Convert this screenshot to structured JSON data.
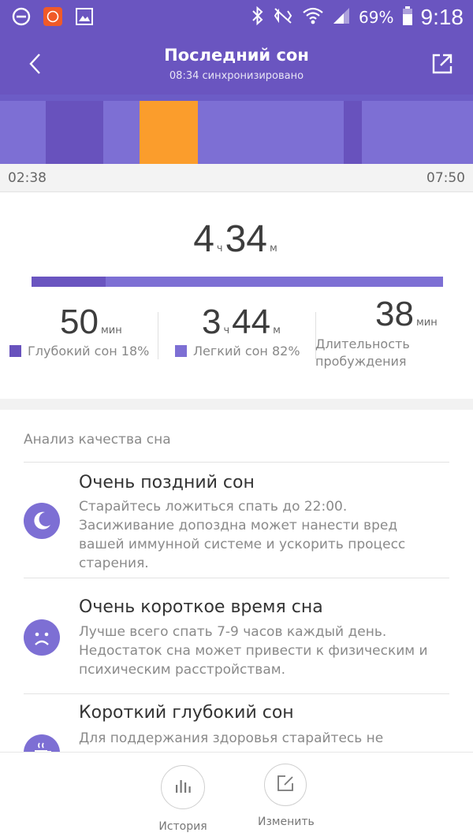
{
  "status_bar": {
    "battery_percent": "69%",
    "time": "9:18",
    "icons": [
      "minus-circle-icon",
      "mi-app-icon",
      "gallery-icon",
      "bluetooth-icon",
      "mute-vibrate-icon",
      "wifi-icon",
      "signal-icon",
      "battery-icon"
    ]
  },
  "header": {
    "title": "Последний сон",
    "subtitle": "08:34 синхронизировано",
    "back_icon": "back-chevron-icon",
    "share_icon": "share-icon"
  },
  "timeline": {
    "start_time": "02:38",
    "end_time": "07:50",
    "segments": [
      {
        "type": "light",
        "start": 0.0,
        "end": 0.097
      },
      {
        "type": "deep",
        "start": 0.097,
        "end": 0.218
      },
      {
        "type": "light",
        "start": 0.218,
        "end": 0.295
      },
      {
        "type": "awake",
        "start": 0.295,
        "end": 0.418
      },
      {
        "type": "light",
        "start": 0.418,
        "end": 0.727
      },
      {
        "type": "deep",
        "start": 0.727,
        "end": 0.765
      },
      {
        "type": "light",
        "start": 0.765,
        "end": 1.0
      }
    ]
  },
  "summary": {
    "total_hours": "4",
    "hours_unit": "ч",
    "total_minutes": "34",
    "minutes_unit": "м",
    "deep_ratio": 0.18
  },
  "stats": {
    "deep": {
      "value": "50",
      "unit": "мин",
      "label": "Глубокий сон 18%"
    },
    "light": {
      "hours": "3",
      "hours_unit": "ч",
      "minutes": "44",
      "minutes_unit": "м",
      "label": "Легкий сон 82%"
    },
    "awake": {
      "value": "38",
      "unit": "мин",
      "label_line1": "Длительность",
      "label_line2": "пробуждения"
    }
  },
  "colors": {
    "header": "#6a55c0",
    "deep": "#6852bd",
    "light": "#7d6fd4",
    "awake": "#fb9d2c"
  },
  "analysis": {
    "title": "Анализ качества сна",
    "items": [
      {
        "icon": "moon-icon",
        "title": "Очень поздний сон",
        "lines": [
          "Старайтесь ложиться спать до 22:00.",
          "Засиживание допоздна может нанести вред",
          "вашей иммунной системе и ускорить процесс",
          "старения."
        ]
      },
      {
        "icon": "sad-face-icon",
        "title": "Очень короткое время сна",
        "lines": [
          "Лучше всего спать 7-9 часов каждый день.",
          "Недостаток сна может привести к физическим и",
          "психическим расстройствам."
        ]
      },
      {
        "icon": "coffee-cup-icon",
        "title": "Короткий глубокий сон",
        "lines": [
          "Для поддержания здоровья старайтесь не"
        ]
      }
    ]
  },
  "bottom_nav": {
    "history_label": "История",
    "edit_label": "Изменить"
  }
}
